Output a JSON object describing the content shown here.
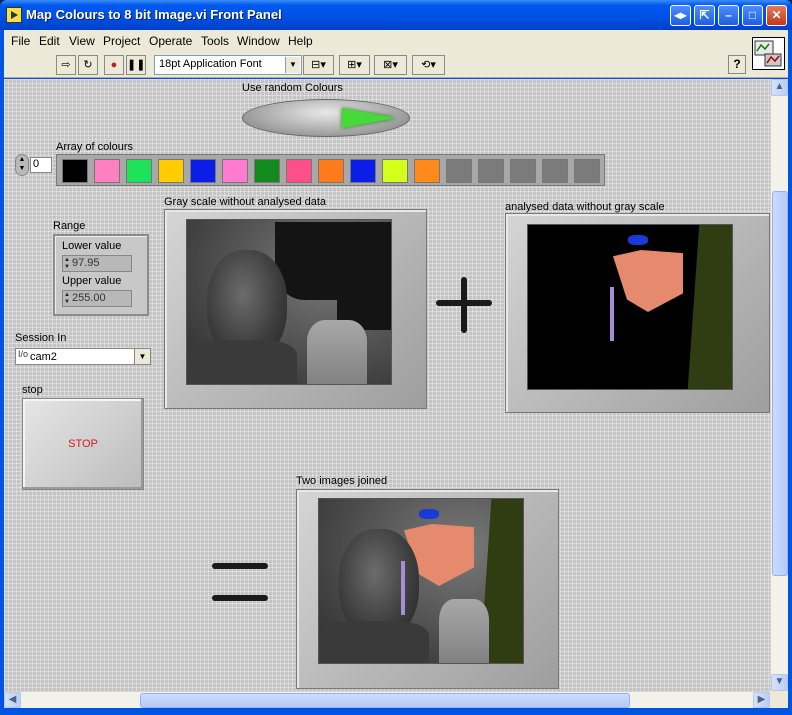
{
  "window": {
    "title": "Map Colours to 8 bit Image.vi Front Panel",
    "buttons": [
      "◂▸",
      "⇱",
      "–",
      "□",
      "✕"
    ]
  },
  "menu": [
    "File",
    "Edit",
    "View",
    "Project",
    "Operate",
    "Tools",
    "Window",
    "Help"
  ],
  "toolbar": {
    "font": "18pt Application Font",
    "help": "?"
  },
  "panel": {
    "toggle_label": "Use random Colours",
    "array_label": "Array of colours",
    "array_index": "0",
    "colours": [
      "#000000",
      "#ff80c0",
      "#1ee35a",
      "#ffcc00",
      "#0b1de8",
      "#ff7bcf",
      "#128a1d",
      "#ff4f8a",
      "#ff7a1a",
      "#0b1de8",
      "#d4ff1a",
      "#ff8a1a",
      "#7b7b7b",
      "#7b7b7b",
      "#7b7b7b",
      "#7b7b7b",
      "#7b7b7b"
    ],
    "range_label": "Range",
    "lower_label": "Lower value",
    "lower_value": "97.95",
    "upper_label": "Upper value",
    "upper_value": "255.00",
    "session_label": "Session In",
    "session_io": "I/o",
    "session_value": "cam2",
    "stop_label": "stop",
    "stop_text": "STOP",
    "img1_label": "Gray scale without analysed data",
    "img2_label": "analysed data without gray scale",
    "img3_label": "Two images joined"
  },
  "colors": {
    "title_bar": "#0054e3",
    "panel_bg": "#c4c4c4",
    "stop_text": "#d41d1d",
    "toggle_lamp": "#46d93a"
  }
}
